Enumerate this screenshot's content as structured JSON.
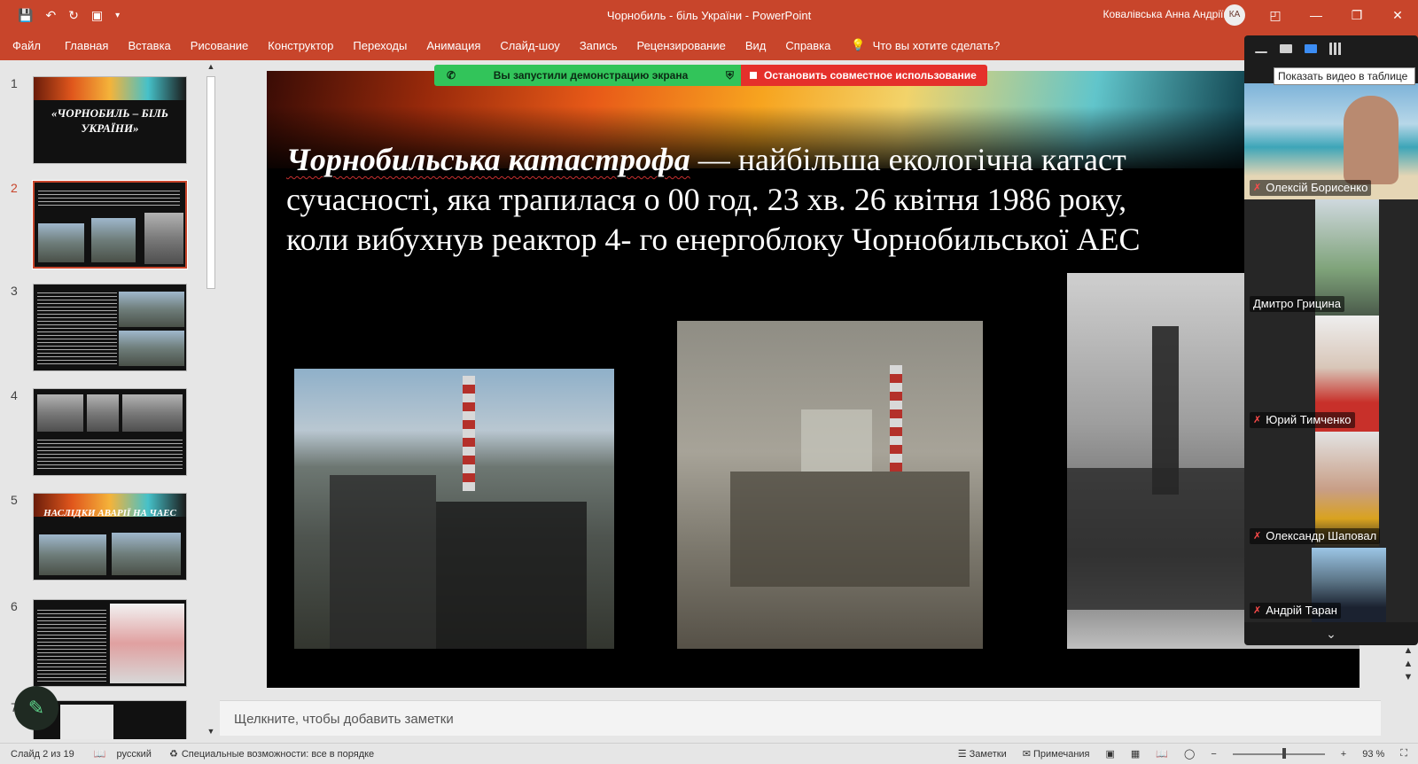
{
  "titlebar": {
    "title": "Чорнобиль - біль України  -  PowerPoint",
    "user_name": "Ковалівська Анна Андріївна",
    "user_initials": "КА"
  },
  "ribbon": {
    "tabs": [
      "Файл",
      "Главная",
      "Вставка",
      "Рисование",
      "Конструктор",
      "Переходы",
      "Анимация",
      "Слайд-шоу",
      "Запись",
      "Рецензирование",
      "Вид",
      "Справка"
    ],
    "tell_me": "Что вы хотите сделать?"
  },
  "thumbnails": {
    "items": [
      {
        "num": "1",
        "title": "«ЧОРНОБИЛЬ – БІЛЬ УКРАЇНИ»"
      },
      {
        "num": "2",
        "title": ""
      },
      {
        "num": "3",
        "title": ""
      },
      {
        "num": "4",
        "title": ""
      },
      {
        "num": "5",
        "title": "НАСЛІДКИ АВАРІЇ НА ЧАЕС"
      },
      {
        "num": "6",
        "title": ""
      },
      {
        "num": "7",
        "title": ""
      }
    ],
    "active_index": 1
  },
  "slide": {
    "heading_emphasis": "Чорнобильська катастрофа",
    "line1_rest": " — найбільша екологічна катаст",
    "line2": "сучасності, яка трапилася о 00 год. 23 хв. 26 квітня 1986 року,",
    "line3": "коли вибухнув реактор 4- го енергоблоку Чорнобильської АЕС"
  },
  "share_bar": {
    "status": "Вы запустили демонстрацию экрана",
    "stop": "Остановить совместное использование"
  },
  "notes": {
    "placeholder": "Щелкните, чтобы добавить заметки"
  },
  "status_bar": {
    "slide_info": "Слайд 2 из 19",
    "language": "русский",
    "accessibility": "Специальные возможности: все в порядке",
    "notes_btn": "Заметки",
    "comments_btn": "Примечания",
    "zoom": "93 %",
    "zoom_level": 0.56
  },
  "video_panel": {
    "tooltip": "Показать видео в таблице",
    "participants": [
      {
        "name": "Олексій Борисенко",
        "muted": true
      },
      {
        "name": "Дмитро Грицина",
        "muted": false
      },
      {
        "name": "Юрий Тимченко",
        "muted": true
      },
      {
        "name": "Олександр Шаповал",
        "muted": true
      },
      {
        "name": "Андрій Таран",
        "muted": true
      }
    ]
  },
  "colors": {
    "accent": "#c8452b",
    "share_green": "#32c45a",
    "share_red": "#e5302b"
  }
}
